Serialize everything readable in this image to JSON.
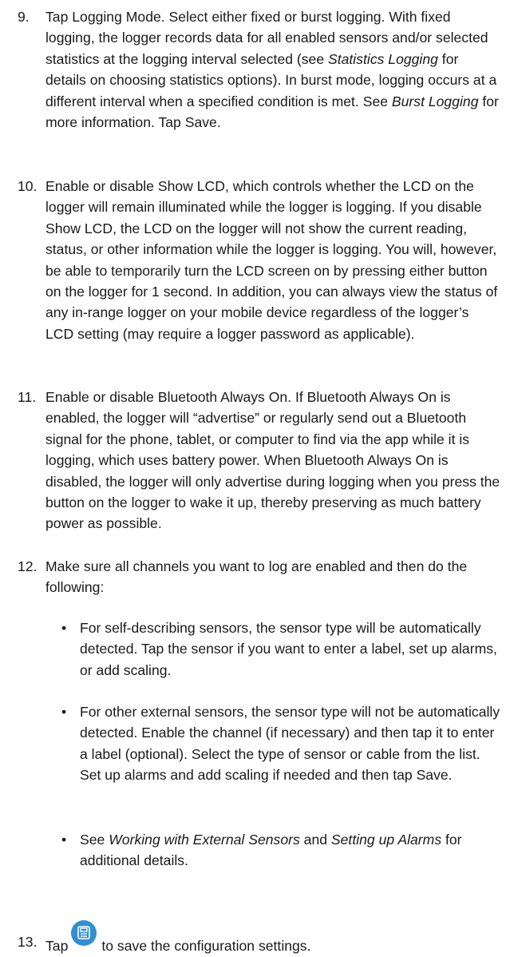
{
  "steps": [
    {
      "num": "9.",
      "parts": [
        "Tap Logging Mode. Select either fixed or burst logging. With fixed logging, the logger records data for all enabled sensors and/or selected statistics at the logging interval selected (see ",
        "Statistics Logging",
        " for details on choosing statistics options). In burst mode, logging occurs at a different interval when a specified condition is met. See ",
        "Burst Logging",
        " for more information. Tap Save."
      ]
    },
    {
      "num": "10.",
      "text": "Enable or disable Show LCD, which controls whether the LCD on the logger will remain illuminated while the logger is logging. If you disable Show LCD, the LCD on the logger will not show the current reading, status, or other information while the logger is logging. You will, however, be able to temporarily turn the LCD screen on by pressing either button on the logger for 1 second. In addition, you can always view the status of any in-range logger on your mobile device regardless of the logger’s LCD setting (may require a logger password as applicable)."
    },
    {
      "num": "11.",
      "text": "Enable or disable Bluetooth Always On. If Bluetooth Always On is enabled, the logger will “advertise” or regularly send out a Bluetooth signal for the phone, tablet, or computer to find via the app while it is logging, which uses battery power. When Bluetooth Always On is disabled, the logger will only advertise during logging when you press the button on the logger to wake it up, thereby preserving as much battery power as possible."
    },
    {
      "num": "12.",
      "text": "Make sure all channels you want to log are enabled and then do the following:"
    }
  ],
  "bullets": [
    {
      "text": "For self-describing sensors, the sensor type will be automatically detected. Tap the sensor if you want to enter a label, set up alarms, or add scaling."
    },
    {
      "text": "For other external sensors, the sensor type will not be automatically detected. Enable the channel (if necessary) and then tap it to enter a label (optional). Select the type of sensor or cable from the list. Set up alarms and add scaling if needed and then tap Save."
    },
    {
      "parts": [
        "See ",
        "Working with External Sensors",
        " and ",
        "Setting up Alarms",
        " for additional details."
      ]
    }
  ],
  "last_step": {
    "num": "13.",
    "before": "Tap",
    "after": "to save the configuration settings.",
    "icon": "save-icon",
    "icon_color": "#2f8fd0"
  },
  "bullet_glyph": "•"
}
